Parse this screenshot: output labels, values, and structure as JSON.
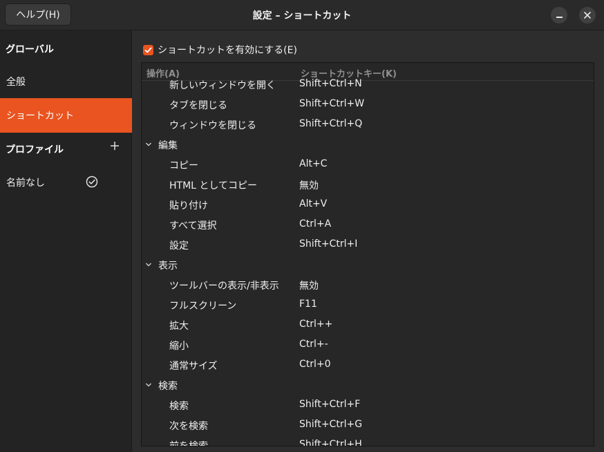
{
  "titlebar": {
    "help_label": "ヘルプ(H)",
    "title": "設定 – ショートカット"
  },
  "sidebar": {
    "global_header": "グローバル",
    "items": [
      {
        "label": "全般"
      },
      {
        "label": "ショートカット"
      }
    ],
    "profile_header": "プロファイル",
    "profiles": [
      {
        "label": "名前なし"
      }
    ]
  },
  "main": {
    "enable_label": "ショートカットを有効にする(E)",
    "columns": {
      "action": "操作(A)",
      "key": "ショートカットキー(K)"
    },
    "rows": [
      {
        "type": "item",
        "action": "新しいウィンドウを開く",
        "key": "Shift+Ctrl+N"
      },
      {
        "type": "item",
        "action": "タブを閉じる",
        "key": "Shift+Ctrl+W"
      },
      {
        "type": "item",
        "action": "ウィンドウを閉じる",
        "key": "Shift+Ctrl+Q"
      },
      {
        "type": "group",
        "action": "編集",
        "key": ""
      },
      {
        "type": "item",
        "action": "コピー",
        "key": "Alt+C"
      },
      {
        "type": "item",
        "action": "HTML としてコピー",
        "key": "無効"
      },
      {
        "type": "item",
        "action": "貼り付け",
        "key": "Alt+V"
      },
      {
        "type": "item",
        "action": "すべて選択",
        "key": "Ctrl+A"
      },
      {
        "type": "item",
        "action": "設定",
        "key": "Shift+Ctrl+I"
      },
      {
        "type": "group",
        "action": "表示",
        "key": ""
      },
      {
        "type": "item",
        "action": "ツールバーの表示/非表示",
        "key": "無効"
      },
      {
        "type": "item",
        "action": "フルスクリーン",
        "key": "F11"
      },
      {
        "type": "item",
        "action": "拡大",
        "key": "Ctrl++"
      },
      {
        "type": "item",
        "action": "縮小",
        "key": "Ctrl+-"
      },
      {
        "type": "item",
        "action": "通常サイズ",
        "key": "Ctrl+0"
      },
      {
        "type": "group",
        "action": "検索",
        "key": ""
      },
      {
        "type": "item",
        "action": "検索",
        "key": "Shift+Ctrl+F"
      },
      {
        "type": "item",
        "action": "次を検索",
        "key": "Shift+Ctrl+G"
      },
      {
        "type": "item",
        "action": "前を検索",
        "key": "Shift+Ctrl+H"
      }
    ]
  },
  "colors": {
    "accent": "#e95420",
    "background": "#2d2d2d",
    "sidebar": "#232323"
  }
}
